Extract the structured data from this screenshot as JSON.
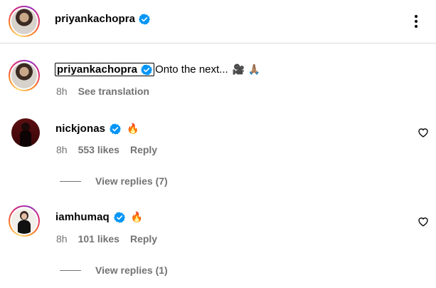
{
  "post": {
    "author": "priyankachopra"
  },
  "caption": {
    "username": "priyankachopra",
    "text": "Onto the next...",
    "emojis": "🎥 🙏🏽",
    "time": "8h",
    "translate_label": "See translation"
  },
  "comments": [
    {
      "username": "nickjonas",
      "text": "🔥",
      "time": "8h",
      "likes": "553 likes",
      "reply_label": "Reply",
      "view_replies": "View replies (7)"
    },
    {
      "username": "iamhumaq",
      "text": "🔥",
      "time": "8h",
      "likes": "101 likes",
      "reply_label": "Reply",
      "view_replies": "View replies (1)"
    }
  ],
  "colors": {
    "verified": "#0095f6",
    "muted": "#737373",
    "border": "#dbdbdb"
  },
  "icons": {
    "more": "more-options-icon",
    "verified": "verified-badge-icon",
    "like": "heart-outline-icon"
  }
}
